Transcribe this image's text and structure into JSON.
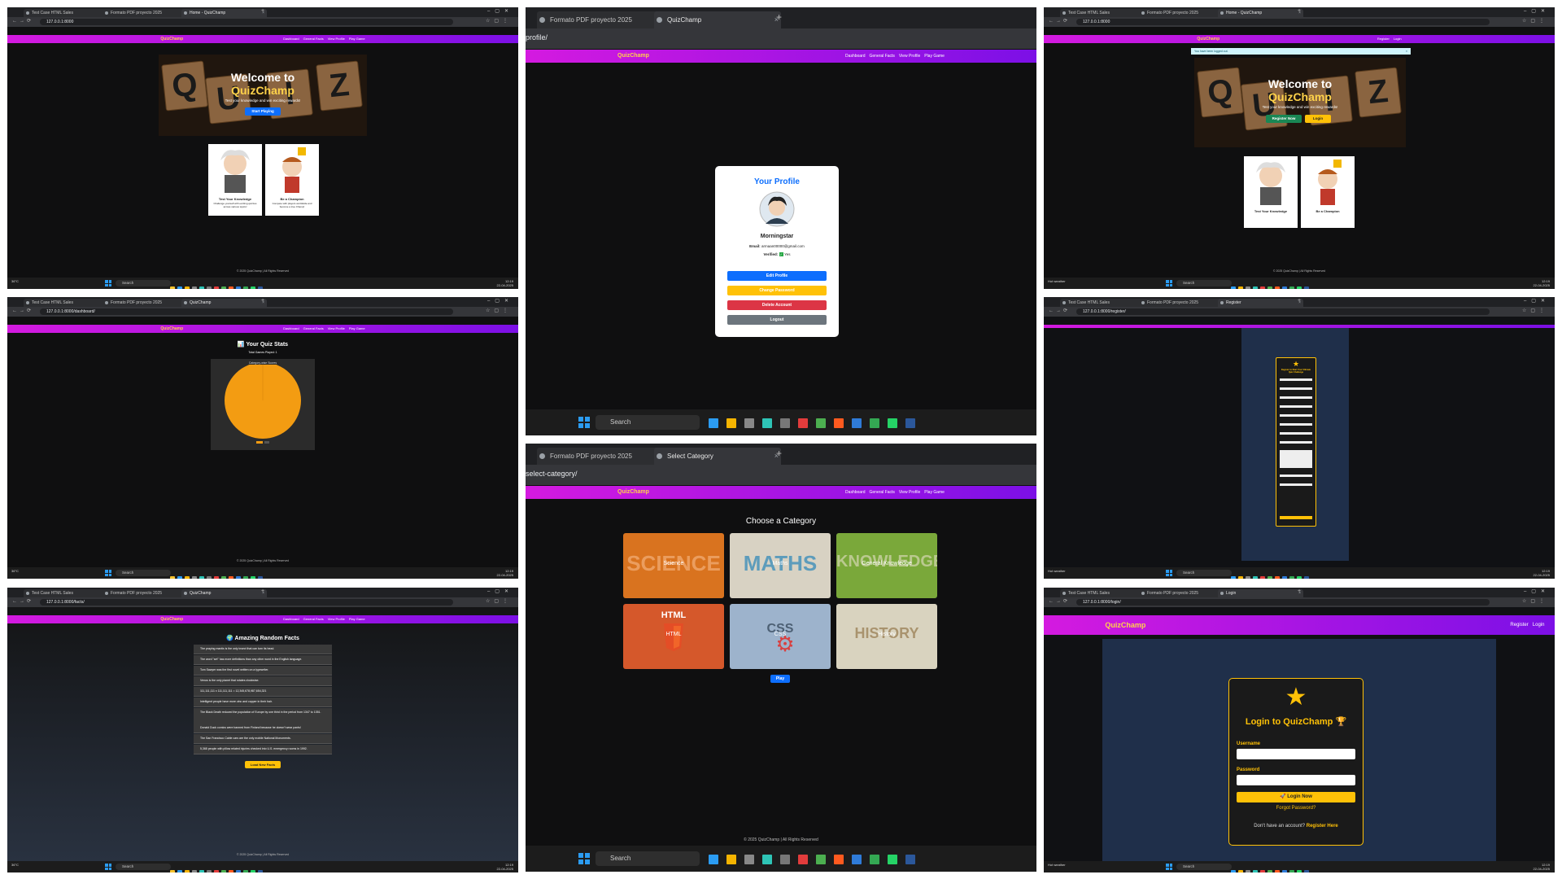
{
  "colors": {
    "nav_start": "#d41ae0",
    "nav_end": "#7c10e6",
    "brand": "#ffd24a",
    "primary": "#0d6efd",
    "success": "#198754",
    "warning": "#ffc107",
    "danger": "#dc3545",
    "secondary": "#6c757d",
    "pie": "#f39c12"
  },
  "brand": "QuizChamp",
  "footer": "© 2025 QuizChamp | All Rights Reserved",
  "taskbar": {
    "search": "Search",
    "weather_temp": "36°C",
    "weather_desc": "Hot weather",
    "lang": "ENG",
    "region": "IN",
    "time": "12:19",
    "date": "22-04-2025"
  },
  "panel1": {
    "tabs": [
      "Test Case HTML Sales",
      "Formato PDF proyecto 2025",
      "Home - QuizChamp"
    ],
    "url": "127.0.0.1:8000",
    "nav_links": [
      "Dashboard",
      "General Facts",
      "View Profile",
      "Play Game"
    ],
    "hero_title": "Welcome to",
    "hero_brand": "QuizChamp",
    "hero_sub": "Test your knowledge and win exciting rewards!",
    "start_btn": "Start Playing",
    "card1": "Test Your Knowledge",
    "card1_sub": "Challenge yourself with exciting quizzes across various topics!",
    "card2": "Be a Champion",
    "card2_sub": "Compete with players worldwide and become a true Champ!"
  },
  "panel2": {
    "tabs": [
      "Formato PDF proyecto 2025",
      "QuizChamp"
    ],
    "url": "profile/",
    "nav_links": [
      "Dashboard",
      "General Facts",
      "View Profile",
      "Play Game"
    ],
    "title": "Your Profile",
    "username": "Morningstar",
    "email_label": "Email:",
    "email": "armaan00000@gmail.com",
    "verified_label": "Verified:",
    "verified": "Yes",
    "edit": "Edit Profile",
    "change_pw": "Change Password",
    "delete": "Delete Account",
    "logout": "Logout"
  },
  "panel3": {
    "tabs": [
      "Test Case HTML Sales",
      "Formato PDF proyecto 2025",
      "Home - QuizChamp"
    ],
    "url": "127.0.0.1:8000",
    "nav_links": [
      "Register",
      "Login"
    ],
    "alert": "You have been logged out.",
    "hero_title": "Welcome to",
    "hero_brand": "QuizChamp",
    "hero_sub": "Test your knowledge and win exciting rewards!",
    "register_btn": "Register Now",
    "login_btn": "Login",
    "card1": "Test Your Knowledge",
    "card2": "Be a Champion"
  },
  "panel4": {
    "tabs": [
      "Test Case HTML Sales",
      "Formato PDF proyecto 2025",
      "QuizChamp"
    ],
    "url": "127.0.0.1:8000/dashboard/",
    "nav_links": [
      "Dashboard",
      "General Facts",
      "View Profile",
      "Play Game"
    ],
    "title": "Your Quiz Stats",
    "subtitle": "Total Games Played: 1",
    "chart_title": "Category-wise Scores"
  },
  "panel5": {
    "tabs": [
      "Test Case HTML Sales",
      "Formato PDF proyecto 2025",
      "Register"
    ],
    "url": "127.0.0.1:8000/register/",
    "title": "Register to Start Your Ultimate Quiz Challenge"
  },
  "panel6": {
    "tabs": [
      "Formato PDF proyecto 2025",
      "Select Category"
    ],
    "url": "select-category/",
    "nav_links": [
      "Dashboard",
      "General Facts",
      "View Profile",
      "Play Game"
    ],
    "title": "Choose a Category",
    "categories": [
      {
        "label": "Science",
        "bg": "#d9731f",
        "art": "SCIENCE"
      },
      {
        "label": "Maths",
        "bg": "#d8d2c3",
        "art": "MATHS"
      },
      {
        "label": "General Knowledge",
        "bg": "#7aa83a",
        "art": "KNOWLEDGE"
      },
      {
        "label": "HTML",
        "bg": "#d5582b",
        "art": "HTML"
      },
      {
        "label": "CSS",
        "bg": "#9db3cc",
        "art": "CSS"
      },
      {
        "label": "History",
        "bg": "#d9d3bf",
        "art": "HISTORY"
      }
    ],
    "play": "Play"
  },
  "panel7": {
    "tabs": [
      "Test Case HTML Sales",
      "Formato PDF proyecto 2025",
      "QuizChamp"
    ],
    "url": "127.0.0.1:8000/facts/",
    "nav_links": [
      "Dashboard",
      "General Facts",
      "View Profile",
      "Play Game"
    ],
    "title": "Amazing Random Facts",
    "facts": [
      "The praying mantis is the only insect that can turn its head.",
      "The word \"set\" has more definitions than any other word in the English language.",
      "Tom Sawyer was the first novel written on a typewriter.",
      "Venus is the only planet that rotates clockwise.",
      "111,111,111 x 111,111,111 = 12,345,678,987,654,321",
      "Intelligent people have more zinc and copper in their hair.",
      "The Black Death reduced the population of Europe by one third in the period from 1347 to 1351.",
      "Donald Duck comics were banned from Finland because he doesn't wear pants!",
      "The San Francisco Cable cars are the only mobile National Monuments.",
      "5,368 people with pillow related injuries checked into U.S. emergency rooms in 1992."
    ],
    "load_btn": "Load New Facts"
  },
  "panel8": {
    "tabs": [
      "Test Case HTML Sales",
      "Formato PDF proyecto 2025",
      "Login"
    ],
    "url": "127.0.0.1:8000/login/",
    "nav_links": [
      "Register",
      "Login"
    ],
    "title": "Login to QuizChamp 🏆",
    "username_label": "Username",
    "password_label": "Password",
    "login_btn": "Login Now",
    "forgot": "Forgot Password?",
    "no_account": "Don't have an account?",
    "register_link": "Register Here"
  }
}
